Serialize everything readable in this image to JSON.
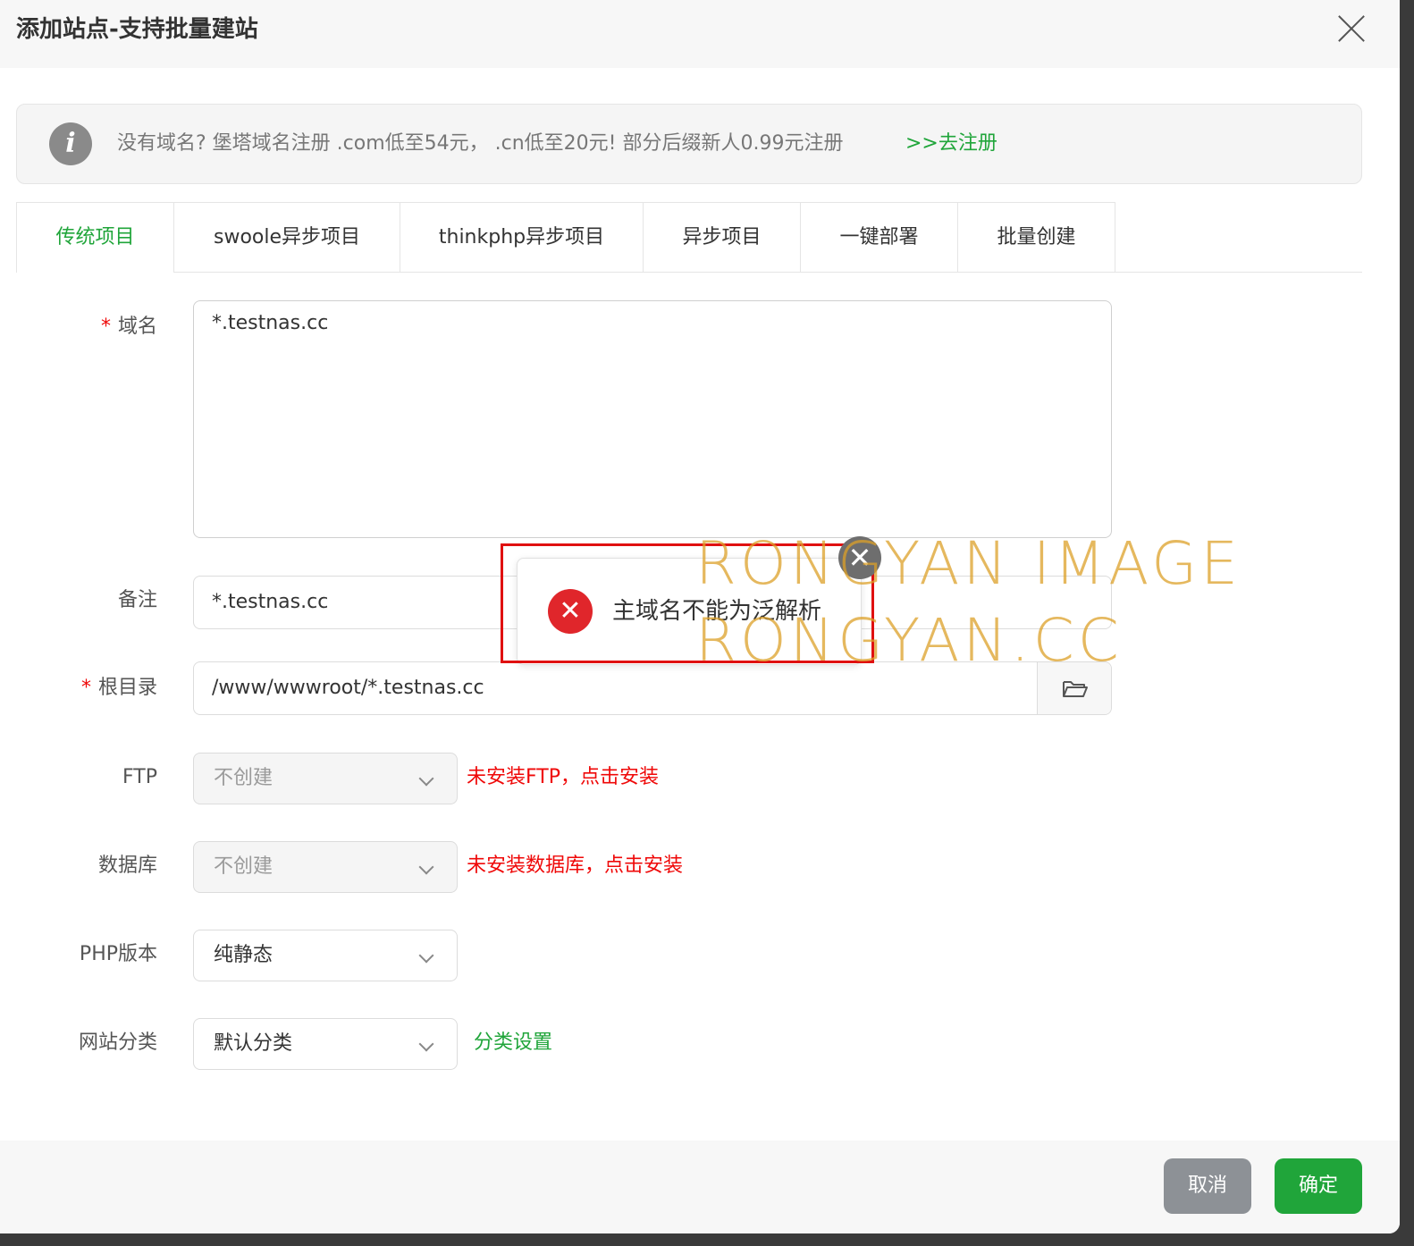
{
  "dialog": {
    "title": "添加站点-支持批量建站"
  },
  "notice": {
    "text": "没有域名? 堡塔域名注册 .com低至54元， .cn低至20元! 部分后缀新人0.99元注册",
    "link": ">>去注册"
  },
  "tabs": [
    {
      "label": "传统项目"
    },
    {
      "label": "swoole异步项目"
    },
    {
      "label": "thinkphp异步项目"
    },
    {
      "label": "异步项目"
    },
    {
      "label": "一键部署"
    },
    {
      "label": "批量创建"
    }
  ],
  "form": {
    "required_mark": "*",
    "domain": {
      "label": "域名",
      "value": "*.testnas.cc"
    },
    "remark": {
      "label": "备注",
      "value": "*.testnas.cc"
    },
    "root": {
      "label": "根目录",
      "value": "/www/wwwroot/*.testnas.cc"
    },
    "ftp": {
      "label": "FTP",
      "value": "不创建",
      "hint": "未安装FTP，点击安装"
    },
    "database": {
      "label": "数据库",
      "value": "不创建",
      "hint": "未安装数据库，点击安装"
    },
    "php": {
      "label": "PHP版本",
      "value": "纯静态"
    },
    "category": {
      "label": "网站分类",
      "value": "默认分类",
      "link": "分类设置"
    }
  },
  "toast": {
    "message": "主域名不能为泛解析",
    "icon": "error-circle-icon"
  },
  "footer": {
    "cancel": "取消",
    "confirm": "确定"
  },
  "watermark": {
    "line1": "RONGYAN IMAGE",
    "line2": "RONGYAN.CC"
  },
  "colors": {
    "accent": "#20a53a",
    "error": "#ef0808",
    "cancel_button": "#8d9196"
  }
}
